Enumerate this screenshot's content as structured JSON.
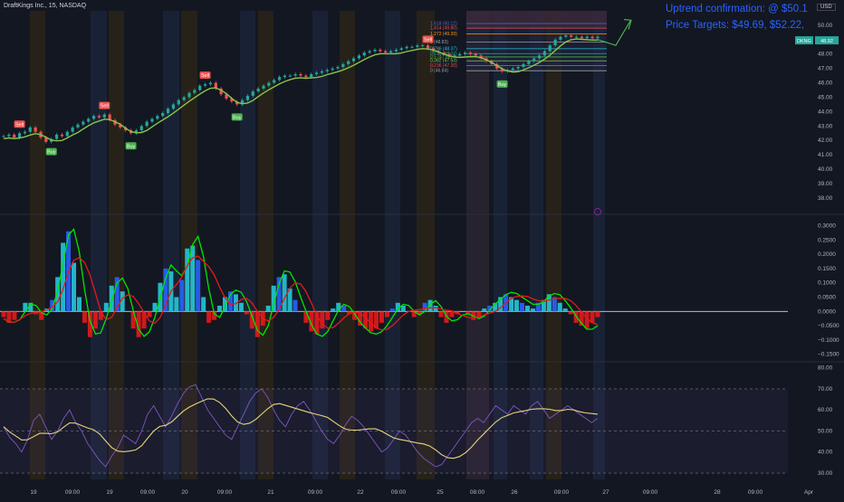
{
  "header": {
    "symbol_title": "DraftKings Inc., 15, NASDAQ",
    "currency": "USD"
  },
  "annotations": {
    "uptrend": "Uptrend confirmation: @ $50.1",
    "targets": "Price Targets: $49.69, $52.22,"
  },
  "ticker_badge": {
    "symbol": "DKNG",
    "price": "48.92"
  },
  "colors": {
    "bg": "#131722",
    "up": "#26a69a",
    "down": "#ef5350",
    "trend": "#8bc34a",
    "signal": "#f0e442",
    "macd_fast": "#00e600",
    "macd_slow": "#e61919",
    "rsi": "#7e57c2",
    "rsi_ma": "#e8d57a",
    "accent": "#2962ff"
  },
  "chart_data": [
    {
      "type": "line",
      "panel": "price",
      "y_ticks": [
        "50.00",
        "49.00",
        "48.00",
        "47.00",
        "46.00",
        "45.00",
        "44.00",
        "43.00",
        "42.00",
        "41.00",
        "40.00",
        "39.00",
        "38.00"
      ],
      "ylim": [
        37.3,
        51.0
      ],
      "series": [
        {
          "values": [
            42.3,
            42.4,
            42.2,
            42.5,
            42.6,
            42.9,
            42.6,
            42.2,
            41.9,
            42.1,
            42.4,
            42.3,
            42.6,
            42.9,
            43.1,
            43.3,
            43.5,
            43.7,
            43.6,
            43.8,
            43.4,
            43.1,
            42.9,
            42.7,
            42.5,
            42.7,
            43.0,
            43.3,
            43.5,
            43.7,
            43.9,
            44.2,
            44.5,
            44.8,
            45.0,
            45.3,
            45.5,
            45.8,
            45.9,
            46.0,
            45.6,
            45.2,
            44.9,
            44.7,
            44.5,
            44.8,
            45.1,
            45.4,
            45.6,
            45.8,
            46.0,
            46.2,
            46.4,
            46.5,
            46.5,
            46.6,
            46.5,
            46.4,
            46.6,
            46.7,
            46.8,
            46.9,
            47.0,
            47.1,
            47.3,
            47.5,
            47.7,
            47.9,
            48.1,
            48.2,
            48.3,
            48.2,
            48.1,
            48.2,
            48.3,
            48.4,
            48.5,
            48.5,
            48.6,
            48.6,
            48.4,
            48.2,
            48.1,
            48.0,
            47.9,
            47.9,
            48.0,
            48.1,
            48.0,
            47.9,
            47.7,
            47.5,
            47.3,
            47.0,
            46.8,
            46.9,
            47.0,
            47.1,
            47.3,
            47.5,
            47.7,
            47.9,
            48.2,
            48.6,
            49.0,
            49.2,
            49.3,
            49.2,
            49.2,
            49.1,
            49.2,
            49.1,
            49.2
          ]
        }
      ],
      "signals": [
        {
          "label": "Sell",
          "i": 3
        },
        {
          "label": "Buy",
          "i": 9
        },
        {
          "label": "Sell",
          "i": 19
        },
        {
          "label": "Buy",
          "i": 24
        },
        {
          "label": "Sell",
          "i": 38
        },
        {
          "label": "Buy",
          "i": 44
        },
        {
          "label": "Sell",
          "i": 80
        },
        {
          "label": "Buy",
          "i": 94
        }
      ],
      "fib_levels": [
        {
          "label": "1.618 (50.12)",
          "value": 50.12,
          "color": "#5c6bc0"
        },
        {
          "label": "1.414 (49.80)",
          "value": 49.8,
          "color": "#ef5350"
        },
        {
          "label": "1.272 (49.39)",
          "value": 49.39,
          "color": "#ff9800"
        },
        {
          "label": "1 (48.83)",
          "value": 48.83,
          "color": "#9e9e9e"
        },
        {
          "label": "0.786 (48.37)",
          "value": 48.37,
          "color": "#26c6da"
        },
        {
          "label": "0.618 (48.03)",
          "value": 48.03,
          "color": "#26a69a"
        },
        {
          "label": "0.5 (47.80)",
          "value": 47.8,
          "color": "#4caf50"
        },
        {
          "label": "0.382 (47.53)",
          "value": 47.53,
          "color": "#8bc34a"
        },
        {
          "label": "0.236 (47.20)",
          "value": 47.2,
          "color": "#ef5350"
        },
        {
          "label": "0 (46.84)",
          "value": 46.84,
          "color": "#9e9e9e"
        }
      ]
    },
    {
      "type": "bar",
      "panel": "macd",
      "y_ticks": [
        "0.3000",
        "0.2500",
        "0.2000",
        "0.1500",
        "0.1000",
        "0.0500",
        "0.0000",
        "−0.0500",
        "−0.1000",
        "−0.1500"
      ],
      "ylim": [
        -0.17,
        0.33
      ],
      "series": [
        {
          "values": [
            -0.02,
            -0.04,
            -0.03,
            0.0,
            0.03,
            0.03,
            -0.01,
            -0.03,
            0.01,
            0.04,
            0.12,
            0.24,
            0.28,
            0.17,
            0.05,
            -0.04,
            -0.09,
            -0.06,
            -0.03,
            0.03,
            0.09,
            0.12,
            0.07,
            0.0,
            -0.06,
            -0.09,
            -0.06,
            -0.02,
            0.03,
            0.1,
            0.15,
            0.14,
            0.05,
            0.11,
            0.22,
            0.23,
            0.18,
            0.05,
            -0.04,
            -0.03,
            0.02,
            0.05,
            0.07,
            0.06,
            0.03,
            -0.01,
            -0.06,
            -0.09,
            -0.05,
            0.02,
            0.09,
            0.12,
            0.13,
            0.08,
            0.04,
            0.0,
            -0.04,
            -0.07,
            -0.08,
            -0.06,
            -0.03,
            0.01,
            0.03,
            0.02,
            -0.01,
            -0.03,
            -0.05,
            -0.06,
            -0.07,
            -0.06,
            -0.04,
            -0.02,
            0.01,
            0.03,
            0.02,
            0.0,
            -0.02,
            -0.01,
            0.03,
            0.04,
            0.02,
            -0.02,
            -0.04,
            -0.02,
            -0.01,
            0.0,
            -0.01,
            -0.03,
            -0.02,
            0.01,
            0.02,
            0.03,
            0.05,
            0.06,
            0.05,
            0.04,
            0.03,
            0.02,
            0.01,
            0.03,
            0.04,
            0.06,
            0.05,
            0.03,
            0.01,
            -0.01,
            -0.04,
            -0.05,
            -0.06,
            -0.04,
            -0.02
          ]
        }
      ]
    },
    {
      "type": "line",
      "panel": "rsi",
      "y_ticks": [
        "80.00",
        "70.00",
        "60.00",
        "50.00",
        "40.00",
        "30.00"
      ],
      "ylim": [
        27,
        82
      ],
      "series": [
        {
          "values": [
            52,
            47,
            44,
            40,
            46,
            55,
            58,
            52,
            46,
            50,
            56,
            60,
            54,
            50,
            44,
            40,
            36,
            33,
            38,
            42,
            48,
            46,
            44,
            50,
            58,
            62,
            57,
            52,
            57,
            63,
            68,
            71,
            72,
            66,
            60,
            56,
            52,
            48,
            46,
            52,
            58,
            64,
            68,
            70,
            66,
            60,
            55,
            52,
            58,
            62,
            64,
            60,
            55,
            50,
            46,
            44,
            48,
            53,
            57,
            55,
            52,
            48,
            44,
            40,
            42,
            46,
            50,
            48,
            44,
            40,
            37,
            35,
            33,
            34,
            38,
            42,
            46,
            50,
            54,
            56,
            54,
            58,
            62,
            60,
            58,
            62,
            60,
            58,
            62,
            64,
            60,
            56,
            58,
            60,
            62,
            60,
            58,
            56,
            54,
            56
          ]
        }
      ]
    }
  ],
  "x_ticks": [
    "19",
    "09:00",
    "19",
    "09:00",
    "20",
    "09:00",
    "21",
    "09:00",
    "22",
    "09:00",
    "25",
    "08:00",
    "26",
    "09:00",
    "27",
    "09:00",
    "28",
    "09:00",
    "Apr"
  ]
}
